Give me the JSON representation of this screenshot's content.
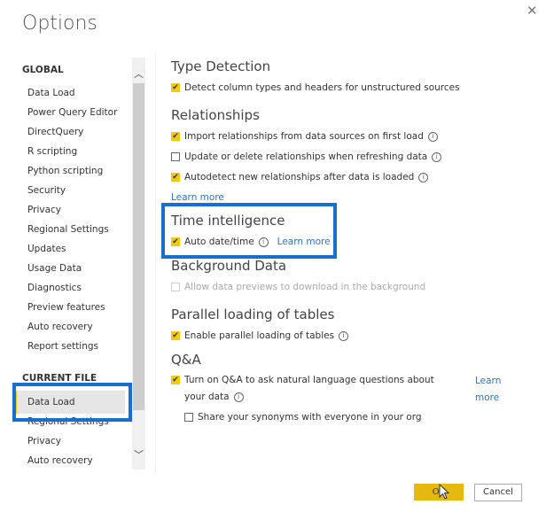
{
  "dialog": {
    "title": "Options",
    "close_icon": "close-icon"
  },
  "nav": {
    "global_header": "GLOBAL",
    "global_items": [
      "Data Load",
      "Power Query Editor",
      "DirectQuery",
      "R scripting",
      "Python scripting",
      "Security",
      "Privacy",
      "Regional Settings",
      "Updates",
      "Usage Data",
      "Diagnostics",
      "Preview features",
      "Auto recovery",
      "Report settings"
    ],
    "current_header": "CURRENT FILE",
    "current_items": [
      "Data Load",
      "Regional Settings",
      "Privacy",
      "Auto recovery"
    ],
    "selected": "Data Load",
    "selected_accent": "#f2c811"
  },
  "sections": {
    "type_detection": {
      "title": "Type Detection",
      "options": [
        {
          "label": "Detect column types and headers for unstructured sources",
          "checked": true
        }
      ]
    },
    "relationships": {
      "title": "Relationships",
      "options": [
        {
          "label": "Import relationships from data sources on first load",
          "checked": true,
          "info": true
        },
        {
          "label": "Update or delete relationships when refreshing data",
          "checked": false,
          "info": true
        },
        {
          "label": "Autodetect new relationships after data is loaded",
          "checked": true,
          "info": true
        }
      ],
      "learn_more": "Learn more"
    },
    "time_intelligence": {
      "title": "Time intelligence",
      "options": [
        {
          "label": "Auto date/time",
          "checked": true,
          "info": true
        }
      ],
      "learn_more": "Learn more"
    },
    "background_data": {
      "title": "Background Data",
      "options": [
        {
          "label": "Allow data previews to download in the background",
          "checked": false,
          "disabled": true
        }
      ]
    },
    "parallel_loading": {
      "title": "Parallel loading of tables",
      "options": [
        {
          "label": "Enable parallel loading of tables",
          "checked": true,
          "info": true
        }
      ]
    },
    "qna": {
      "title": "Q&A",
      "options": [
        {
          "label_line1": "Turn on Q&A to ask natural language questions about",
          "label_line2": "your data",
          "checked": true,
          "info": true
        },
        {
          "label": "Share your synonyms with everyone in your org",
          "checked": false
        }
      ],
      "learn_more_1": "Learn",
      "learn_more_2": "more"
    }
  },
  "footer": {
    "ok_label": "OK",
    "cancel_label": "Cancel"
  },
  "colors": {
    "accent": "#f2c811",
    "highlight": "#1570d1",
    "link": "#2b73c2"
  }
}
